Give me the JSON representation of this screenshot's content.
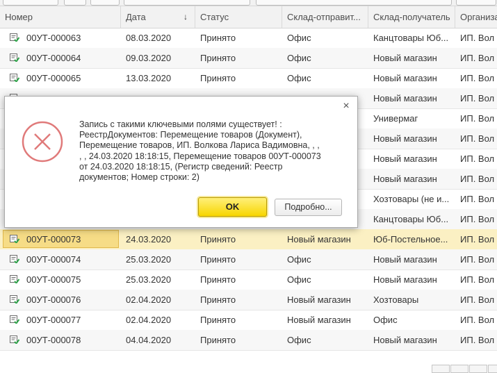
{
  "columns": [
    "Номер",
    "Дата",
    "Статус",
    "Склад-отправит...",
    "Склад-получатель",
    "Организа"
  ],
  "sort_indicator": "↓",
  "rows": [
    {
      "number": "00УТ-000063",
      "date": "08.03.2020",
      "status": "Принято",
      "from": "Офис",
      "to": "Канцтовары Юб...",
      "org": "ИП. Вол"
    },
    {
      "number": "00УТ-000064",
      "date": "09.03.2020",
      "status": "Принято",
      "from": "Офис",
      "to": "Новый магазин",
      "org": "ИП. Вол"
    },
    {
      "number": "00УТ-000065",
      "date": "13.03.2020",
      "status": "Принято",
      "from": "Офис",
      "to": "Новый магазин",
      "org": "ИП. Вол"
    },
    {
      "number": "",
      "date": "",
      "status": "",
      "from": "",
      "to": "Новый магазин",
      "org": "ИП. Вол"
    },
    {
      "number": "",
      "date": "",
      "status": "",
      "from": "",
      "to": "Универмаг",
      "org": "ИП. Вол"
    },
    {
      "number": "",
      "date": "",
      "status": "",
      "from": "",
      "to": "Новый магазин",
      "org": "ИП. Вол"
    },
    {
      "number": "",
      "date": "",
      "status": "",
      "from": "",
      "to": "Новый магазин",
      "org": "ИП. Вол"
    },
    {
      "number": "",
      "date": "",
      "status": "",
      "from": "",
      "to": "Новый магазин",
      "org": "ИП. Вол"
    },
    {
      "number": "",
      "date": "",
      "status": "",
      "from": "",
      "to": "Хозтовары (не и...",
      "org": "ИП. Вол"
    },
    {
      "number": "",
      "date": "",
      "status": "",
      "from": "",
      "to": "Канцтовары Юб...",
      "org": "ИП. Вол"
    },
    {
      "number": "00УТ-000073",
      "date": "24.03.2020",
      "status": "Принято",
      "from": "Новый магазин",
      "to": "Юб-Постельное...",
      "org": "ИП. Вол"
    },
    {
      "number": "00УТ-000074",
      "date": "25.03.2020",
      "status": "Принято",
      "from": "Офис",
      "to": "Новый магазин",
      "org": "ИП. Вол"
    },
    {
      "number": "00УТ-000075",
      "date": "25.03.2020",
      "status": "Принято",
      "from": "Офис",
      "to": "Новый магазин",
      "org": "ИП. Вол"
    },
    {
      "number": "00УТ-000076",
      "date": "02.04.2020",
      "status": "Принято",
      "from": "Новый магазин",
      "to": "Хозтовары",
      "org": "ИП. Вол"
    },
    {
      "number": "00УТ-000077",
      "date": "02.04.2020",
      "status": "Принято",
      "from": "Новый магазин",
      "to": "Офис",
      "org": "ИП. Вол"
    },
    {
      "number": "00УТ-000078",
      "date": "04.04.2020",
      "status": "Принято",
      "from": "Офис",
      "to": "Новый магазин",
      "org": "ИП. Вол"
    }
  ],
  "dialog": {
    "message": "Запись с такими ключевыми полями существует! :\nРеестрДокументов: Перемещение товаров (Документ),\nПеремещение товаров, ИП. Волкова Лариса Вадимовна, , ,\n, , 24.03.2020 18:18:15, Перемещение товаров 00УТ-000073\nот 24.03.2020 18:18:15,  (Регистр сведений: Реестр\nдокументов; Номер строки: 2)",
    "ok_label": "OK",
    "details_label": "Подробно...",
    "close_glyph": "×",
    "icon": "error-circle-x-icon"
  },
  "colors": {
    "selected_row": "#fbf0c3",
    "ok_button": "#f7d500",
    "error_icon": "#e07a7a"
  }
}
